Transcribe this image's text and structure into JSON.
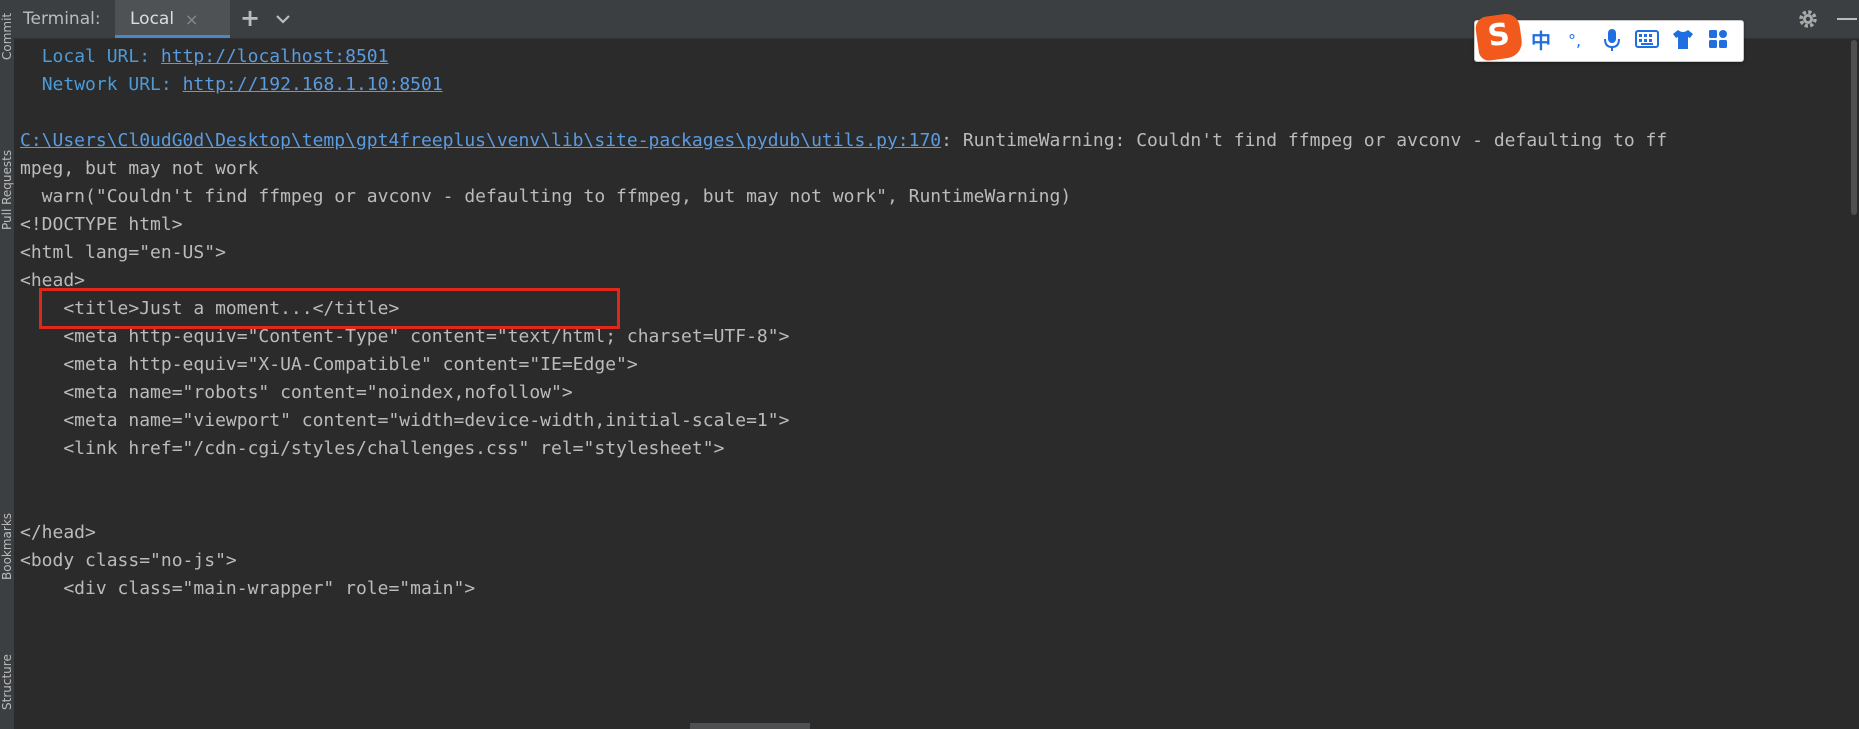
{
  "left_strip": {
    "tabs": [
      "Commit",
      "Pull Requests",
      "Bookmarks",
      "Structure"
    ]
  },
  "header": {
    "title": "Terminal:",
    "active_tab": "Local",
    "close_glyph": "×",
    "new_tab_glyph": "+",
    "dropdown_icon": "chevron-down-icon",
    "settings_icon": "gear-icon",
    "hide_icon": "minimize-icon"
  },
  "ime": {
    "logo": "S",
    "mode": "中",
    "punct": "°,",
    "icons": [
      "microphone-icon",
      "keyboard-icon",
      "skin-icon",
      "toolbox-icon"
    ],
    "accent": "#1f6fe0",
    "logo_color": "#f25a1d"
  },
  "terminal": {
    "local_url_label": "Local URL:",
    "local_url": "http://localhost:8501",
    "network_url_label": "Network URL:",
    "network_url": "http://192.168.1.10:8501",
    "warning_path": "C:\\Users\\Cl0udG0d\\Desktop\\temp\\gpt4freeplus\\venv\\lib\\site-packages\\pydub\\utils.py:170",
    "warning_rest": ": RuntimeWarning: Couldn't find ffmpeg or avconv - defaulting to ff",
    "warning_wrap": "mpeg, but may not work",
    "warn_line": "  warn(\"Couldn't find ffmpeg or avconv - defaulting to ffmpeg, but may not work\", RuntimeWarning)",
    "html_lines": [
      "<!DOCTYPE html>",
      "<html lang=\"en-US\">",
      "<head>",
      "    <title>Just a moment...</title>",
      "    <meta http-equiv=\"Content-Type\" content=\"text/html; charset=UTF-8\">",
      "    <meta http-equiv=\"X-UA-Compatible\" content=\"IE=Edge\">",
      "    <meta name=\"robots\" content=\"noindex,nofollow\">",
      "    <meta name=\"viewport\" content=\"width=device-width,initial-scale=1\">",
      "    <link href=\"/cdn-cgi/styles/challenges.css\" rel=\"stylesheet\">",
      "</head>",
      "<body class=\"no-js\">",
      "    <div class=\"main-wrapper\" role=\"main\">"
    ],
    "highlight_color": "#e0281a",
    "link_color": "#5b9be0",
    "info_color": "#4b9bd8",
    "text_color": "#bbbbbb",
    "background": "#2b2b2b"
  }
}
